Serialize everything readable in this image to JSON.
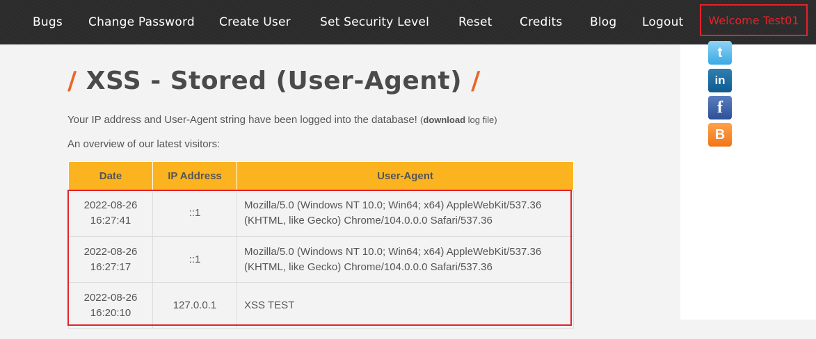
{
  "nav": {
    "items": [
      {
        "label": "Bugs"
      },
      {
        "label": "Change Password"
      },
      {
        "label": "Create User"
      },
      {
        "label": "Set Security Level"
      },
      {
        "label": "Reset"
      },
      {
        "label": "Credits"
      },
      {
        "label": "Blog"
      },
      {
        "label": "Logout"
      }
    ],
    "welcome": "Welcome Test01"
  },
  "social": {
    "icons": [
      "twitter-icon",
      "linkedin-icon",
      "facebook-icon",
      "blogger-icon"
    ]
  },
  "page": {
    "title": "XSS - Stored (User-Agent)",
    "intro_text": "Your IP address and User-Agent string have been logged into the database!",
    "download_prefix": "(",
    "download_link": "download",
    "download_suffix": " log file)",
    "overview_text": "An overview of our latest visitors:"
  },
  "table": {
    "headers": [
      "Date",
      "IP Address",
      "User-Agent"
    ],
    "rows": [
      {
        "date": "2022-08-26",
        "time": "16:27:41",
        "ip": "::1",
        "ua_line1": "Mozilla/5.0 (Windows NT 10.0; Win64; x64) AppleWebKit/537.36",
        "ua_line2": "(KHTML, like Gecko) Chrome/104.0.0.0 Safari/537.36"
      },
      {
        "date": "2022-08-26",
        "time": "16:27:17",
        "ip": "::1",
        "ua_line1": "Mozilla/5.0 (Windows NT 10.0; Win64; x64) AppleWebKit/537.36",
        "ua_line2": "(KHTML, like Gecko) Chrome/104.0.0.0 Safari/537.36"
      },
      {
        "date": "2022-08-26",
        "time": "16:20:10",
        "ip": "127.0.0.1",
        "ua_line1": "XSS TEST",
        "ua_line2": ""
      }
    ]
  },
  "colors": {
    "nav_bg": "#2b2b2b",
    "accent_orange": "#e8682a",
    "table_header": "#fbb41f",
    "highlight_red": "#e3232b"
  }
}
